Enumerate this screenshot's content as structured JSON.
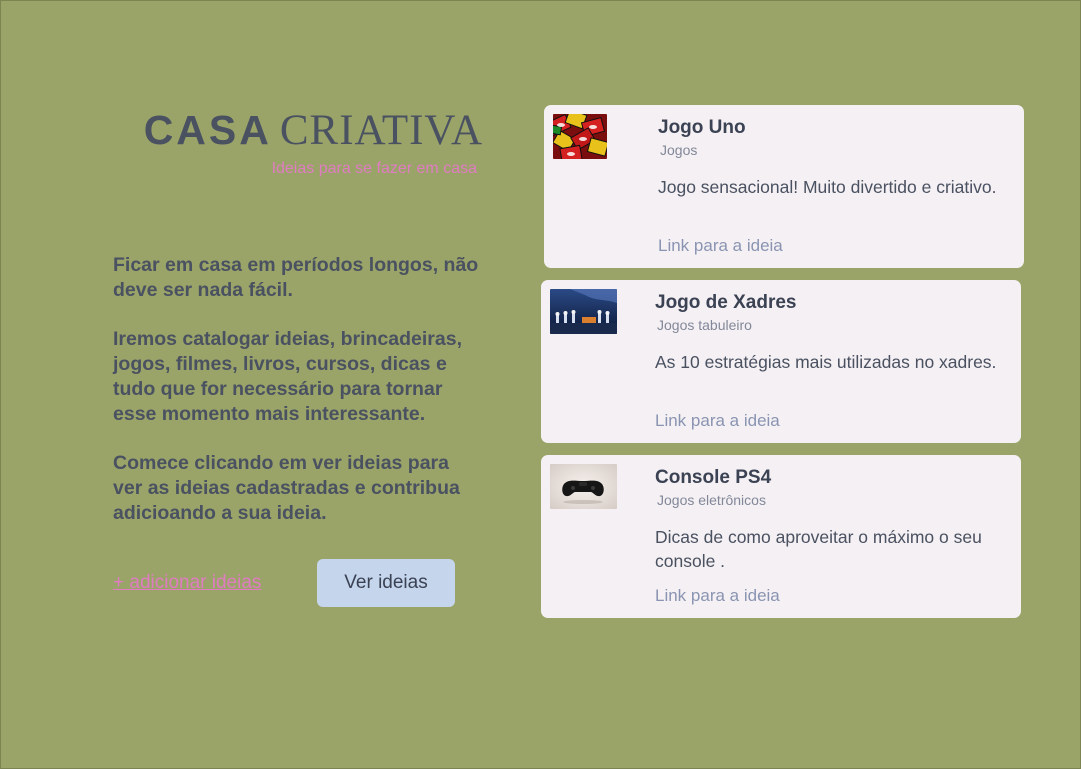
{
  "header": {
    "logo_part1": "CASA",
    "logo_part2": "CRIATIVA",
    "tagline": "Ideias para se fazer em casa"
  },
  "intro": {
    "p1": "Ficar em casa em períodos longos, não deve ser nada fácil.",
    "p2": "Iremos catalogar ideias, brincadeiras, jogos, filmes, livros, cursos, dicas e tudo que for necessário para tornar esse momento mais interessante.",
    "p3": "Comece clicando em ver ideias para ver as ideias cadastradas e contribua adicioando a sua ideia."
  },
  "actions": {
    "add_label": "+ adicionar ideias",
    "view_label": "Ver ideias"
  },
  "ideas": [
    {
      "title": "Jogo Uno",
      "category": "Jogos",
      "description": "Jogo sensacional! Muito divertido e criativo.",
      "link_label": "Link para a ideia",
      "image_icon": "uno-cards-image"
    },
    {
      "title": "Jogo de Xadres",
      "category": "Jogos tabuleiro",
      "description": "As 10 estratégias mais utilizadas no xadres.",
      "link_label": "Link para a ideia",
      "image_icon": "chess-board-image"
    },
    {
      "title": "Console PS4",
      "category": "Jogos eletrônicos",
      "description": "Dicas de como aproveitar o máximo o seu console .",
      "link_label": "Link para a ideia",
      "image_icon": "game-controller-image"
    }
  ],
  "colors": {
    "background": "#9aa468",
    "text": "#4a5161",
    "accent_pink": "#e07cc2",
    "card": "#f4f0f3",
    "button": "#c5d5ec",
    "link": "#8a94b2"
  }
}
